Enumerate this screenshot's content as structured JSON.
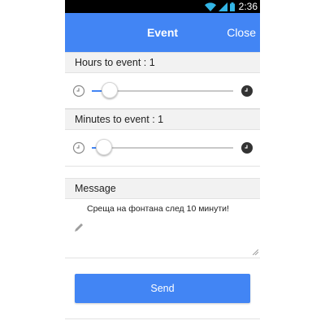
{
  "status_bar": {
    "time": "2:36",
    "icons": [
      "wifi-icon",
      "signal-icon",
      "battery-icon"
    ]
  },
  "app_bar": {
    "title": "Event",
    "close_label": "Close"
  },
  "hours": {
    "label": "Hours to event : 1",
    "value": 1,
    "slider_fraction": 0.1,
    "left_icon": "clock-outline-icon",
    "right_icon": "clock-filled-icon"
  },
  "minutes": {
    "label": "Minutes to event : 1",
    "value": 1,
    "slider_fraction": 0.06,
    "left_icon": "clock-outline-icon",
    "right_icon": "clock-filled-icon"
  },
  "message": {
    "header": "Message",
    "text": "Среща на фонтана след 10 минути!",
    "icon": "pencil-icon"
  },
  "send": {
    "label": "Send"
  },
  "colors": {
    "accent": "#4285f4",
    "status_bar": "#000000",
    "section_header_bg": "#f2f2f2"
  }
}
